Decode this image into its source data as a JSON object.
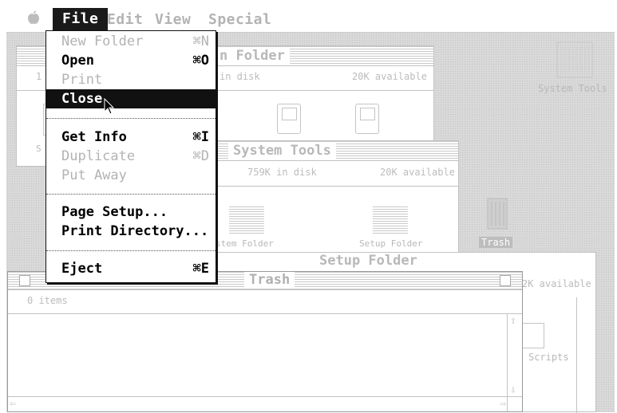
{
  "menubar": {
    "apple_icon": "apple-icon",
    "menus": [
      "File",
      "Edit",
      "View",
      "Special"
    ]
  },
  "file_menu": {
    "new_folder": {
      "label": "New Folder",
      "shortcut": "⌘N"
    },
    "open": {
      "label": "Open",
      "shortcut": "⌘O"
    },
    "print": {
      "label": "Print"
    },
    "close": {
      "label": "Close"
    },
    "get_info": {
      "label": "Get Info",
      "shortcut": "⌘I"
    },
    "duplicate": {
      "label": "Duplicate",
      "shortcut": "⌘D"
    },
    "put_away": {
      "label": "Put Away"
    },
    "page_setup": {
      "label": "Page Setup..."
    },
    "print_directory": {
      "label": "Print Directory..."
    },
    "eject": {
      "label": "Eject",
      "shortcut": "⌘E"
    }
  },
  "desktop": {
    "system_tools_icon_label": "System Tools",
    "trash_icon_label": "Trash"
  },
  "window_system_folder": {
    "title_fragment": "n Folder",
    "count_fragment": "1",
    "disk": "in disk",
    "available": "20K available",
    "icon_label_fragment": "S"
  },
  "window_system_tools": {
    "title": "System Tools",
    "disk": "759K in disk",
    "available": "20K available",
    "icon_left_label": "stem Folder",
    "icon_right_label": "Setup Folder"
  },
  "window_setup_folder": {
    "title": "Setup Folder",
    "available_fragment": "2K available",
    "icon_label": "Scripts"
  },
  "window_trash": {
    "title": "Trash",
    "items": "0 items"
  }
}
